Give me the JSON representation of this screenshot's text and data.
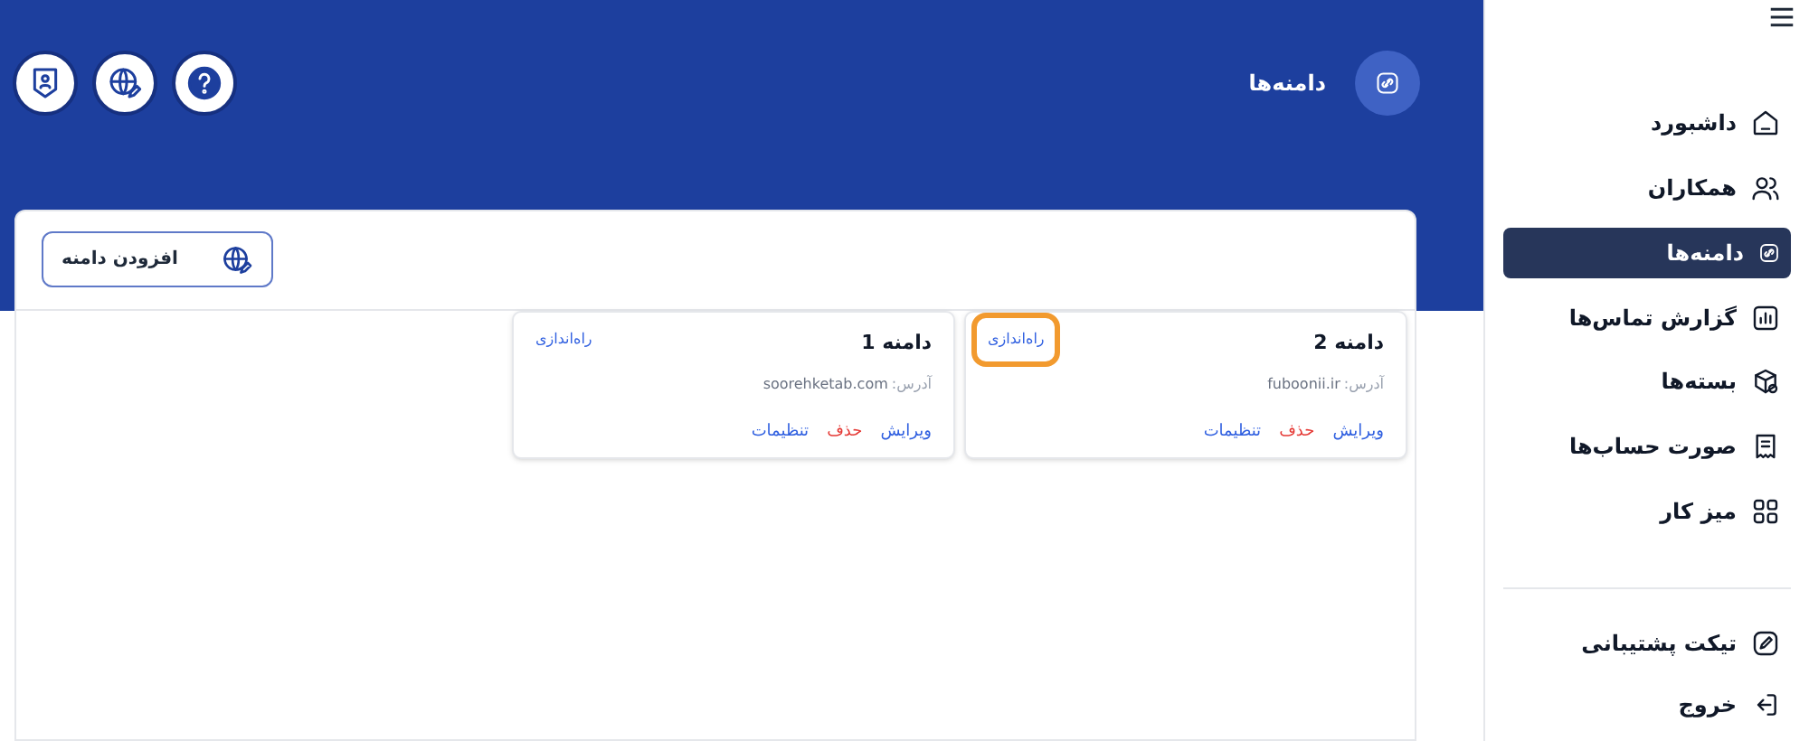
{
  "header": {
    "title": "دامنه‌ها"
  },
  "header_buttons": [
    {
      "kind": "help"
    },
    {
      "kind": "globe"
    },
    {
      "kind": "shield"
    }
  ],
  "add_button": {
    "label": "افزودن دامنه"
  },
  "domains": [
    {
      "name": "دامنه 2",
      "setup": "راه‌اندازی",
      "highlighted": true,
      "address_label": "آدرس:",
      "address": "fuboonii.ir",
      "actions": [
        {
          "kind": "edit",
          "label": "ویرایش"
        },
        {
          "kind": "delete",
          "label": "حذف"
        },
        {
          "kind": "settings",
          "label": "تنظیمات"
        }
      ]
    },
    {
      "name": "دامنه 1",
      "setup": "راه‌اندازی",
      "highlighted": false,
      "address_label": "آدرس:",
      "address": "soorehketab.com",
      "actions": [
        {
          "kind": "edit",
          "label": "ویرایش"
        },
        {
          "kind": "delete",
          "label": "حذف"
        },
        {
          "kind": "settings",
          "label": "تنظیمات"
        }
      ]
    }
  ],
  "sidebar": {
    "items": [
      {
        "kind": "home",
        "label": "داشبورد",
        "selected": false
      },
      {
        "kind": "users",
        "label": "همکاران",
        "selected": false
      },
      {
        "kind": "link",
        "label": "دامنه‌ها",
        "selected": true
      },
      {
        "kind": "chart",
        "label": "گزارش تماس‌ها",
        "selected": false
      },
      {
        "kind": "box",
        "label": "بسته‌ها",
        "selected": false
      },
      {
        "kind": "receipt",
        "label": "صورت حساب‌ها",
        "selected": false
      },
      {
        "kind": "grid",
        "label": "میز کار",
        "selected": false
      }
    ],
    "bottom_items": [
      {
        "kind": "pen",
        "label": "تیکت پشتیبانی"
      },
      {
        "kind": "logout",
        "label": "خروج"
      }
    ]
  }
}
